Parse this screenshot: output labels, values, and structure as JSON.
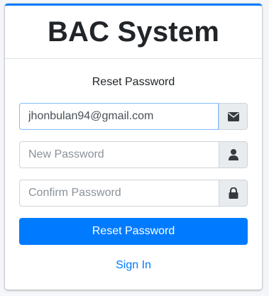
{
  "header": {
    "brand": "BAC System"
  },
  "form": {
    "message": "Reset Password",
    "email": {
      "value": "jhonbulan94@gmail.com",
      "icon": "envelope-icon"
    },
    "new_password": {
      "placeholder": "New Password",
      "icon": "user-icon"
    },
    "confirm_password": {
      "placeholder": "Confirm Password",
      "icon": "lock-icon"
    },
    "submit_label": "Reset Password",
    "signin_link": "Sign In"
  },
  "colors": {
    "accent": "#007bff",
    "addon_bg": "#e9ecef",
    "focus_border": "#80bdff"
  }
}
